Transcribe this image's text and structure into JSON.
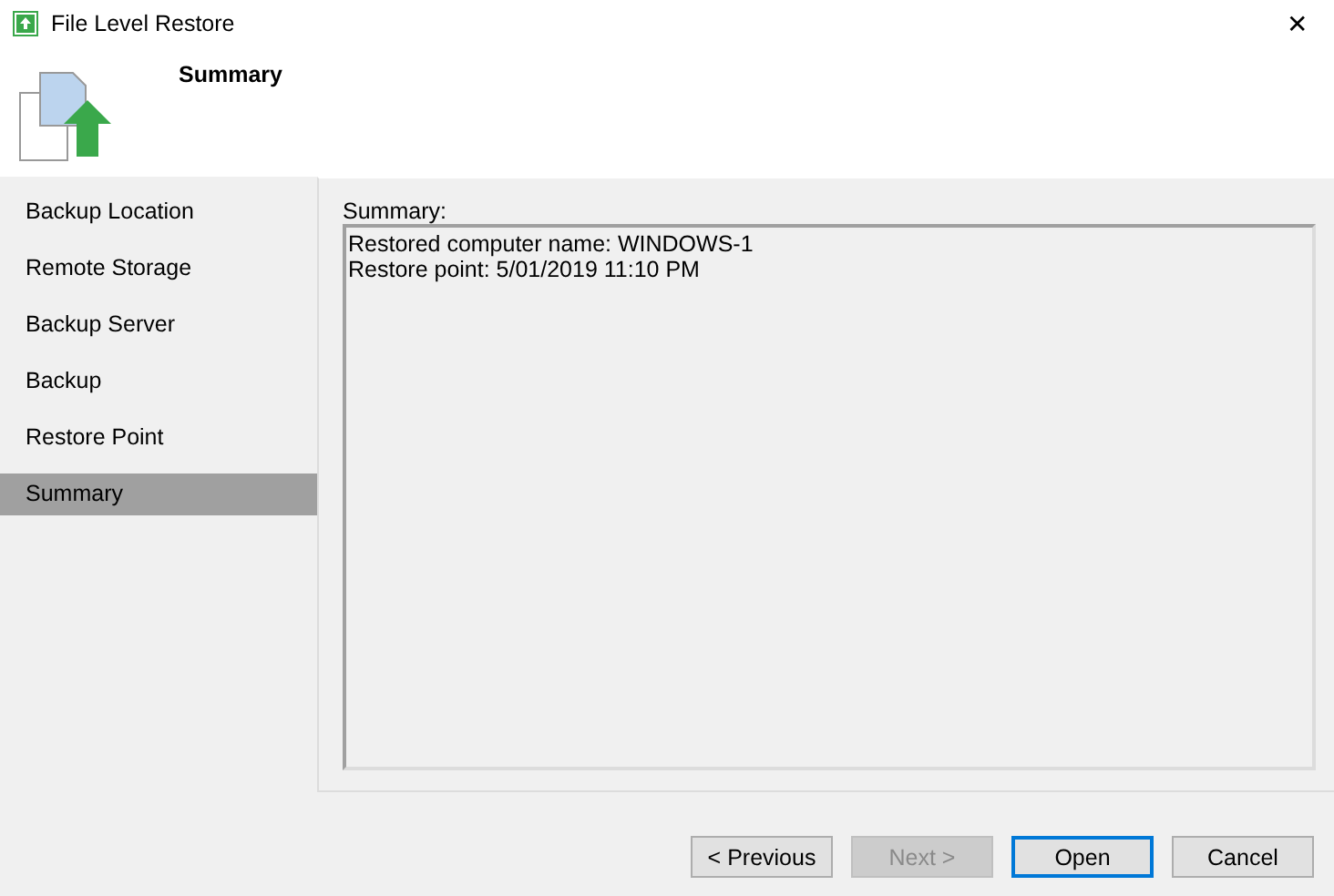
{
  "window": {
    "title": "File Level Restore",
    "close": "✕"
  },
  "header": {
    "title": "Summary"
  },
  "sidebar": {
    "items": [
      {
        "label": "Backup Location",
        "selected": false
      },
      {
        "label": "Remote Storage",
        "selected": false
      },
      {
        "label": "Backup Server",
        "selected": false
      },
      {
        "label": "Backup",
        "selected": false
      },
      {
        "label": "Restore Point",
        "selected": false
      },
      {
        "label": "Summary",
        "selected": true
      }
    ]
  },
  "summary": {
    "label": "Summary:",
    "lines": [
      "Restored computer name: WINDOWS-1",
      "Restore point: 5/01/2019 11:10 PM"
    ]
  },
  "buttons": [
    {
      "label": "< Previous",
      "disabled": false,
      "default": false
    },
    {
      "label": "Next >",
      "disabled": true,
      "default": false
    },
    {
      "label": "Open",
      "disabled": false,
      "default": true
    },
    {
      "label": "Cancel",
      "disabled": false,
      "default": false
    }
  ]
}
